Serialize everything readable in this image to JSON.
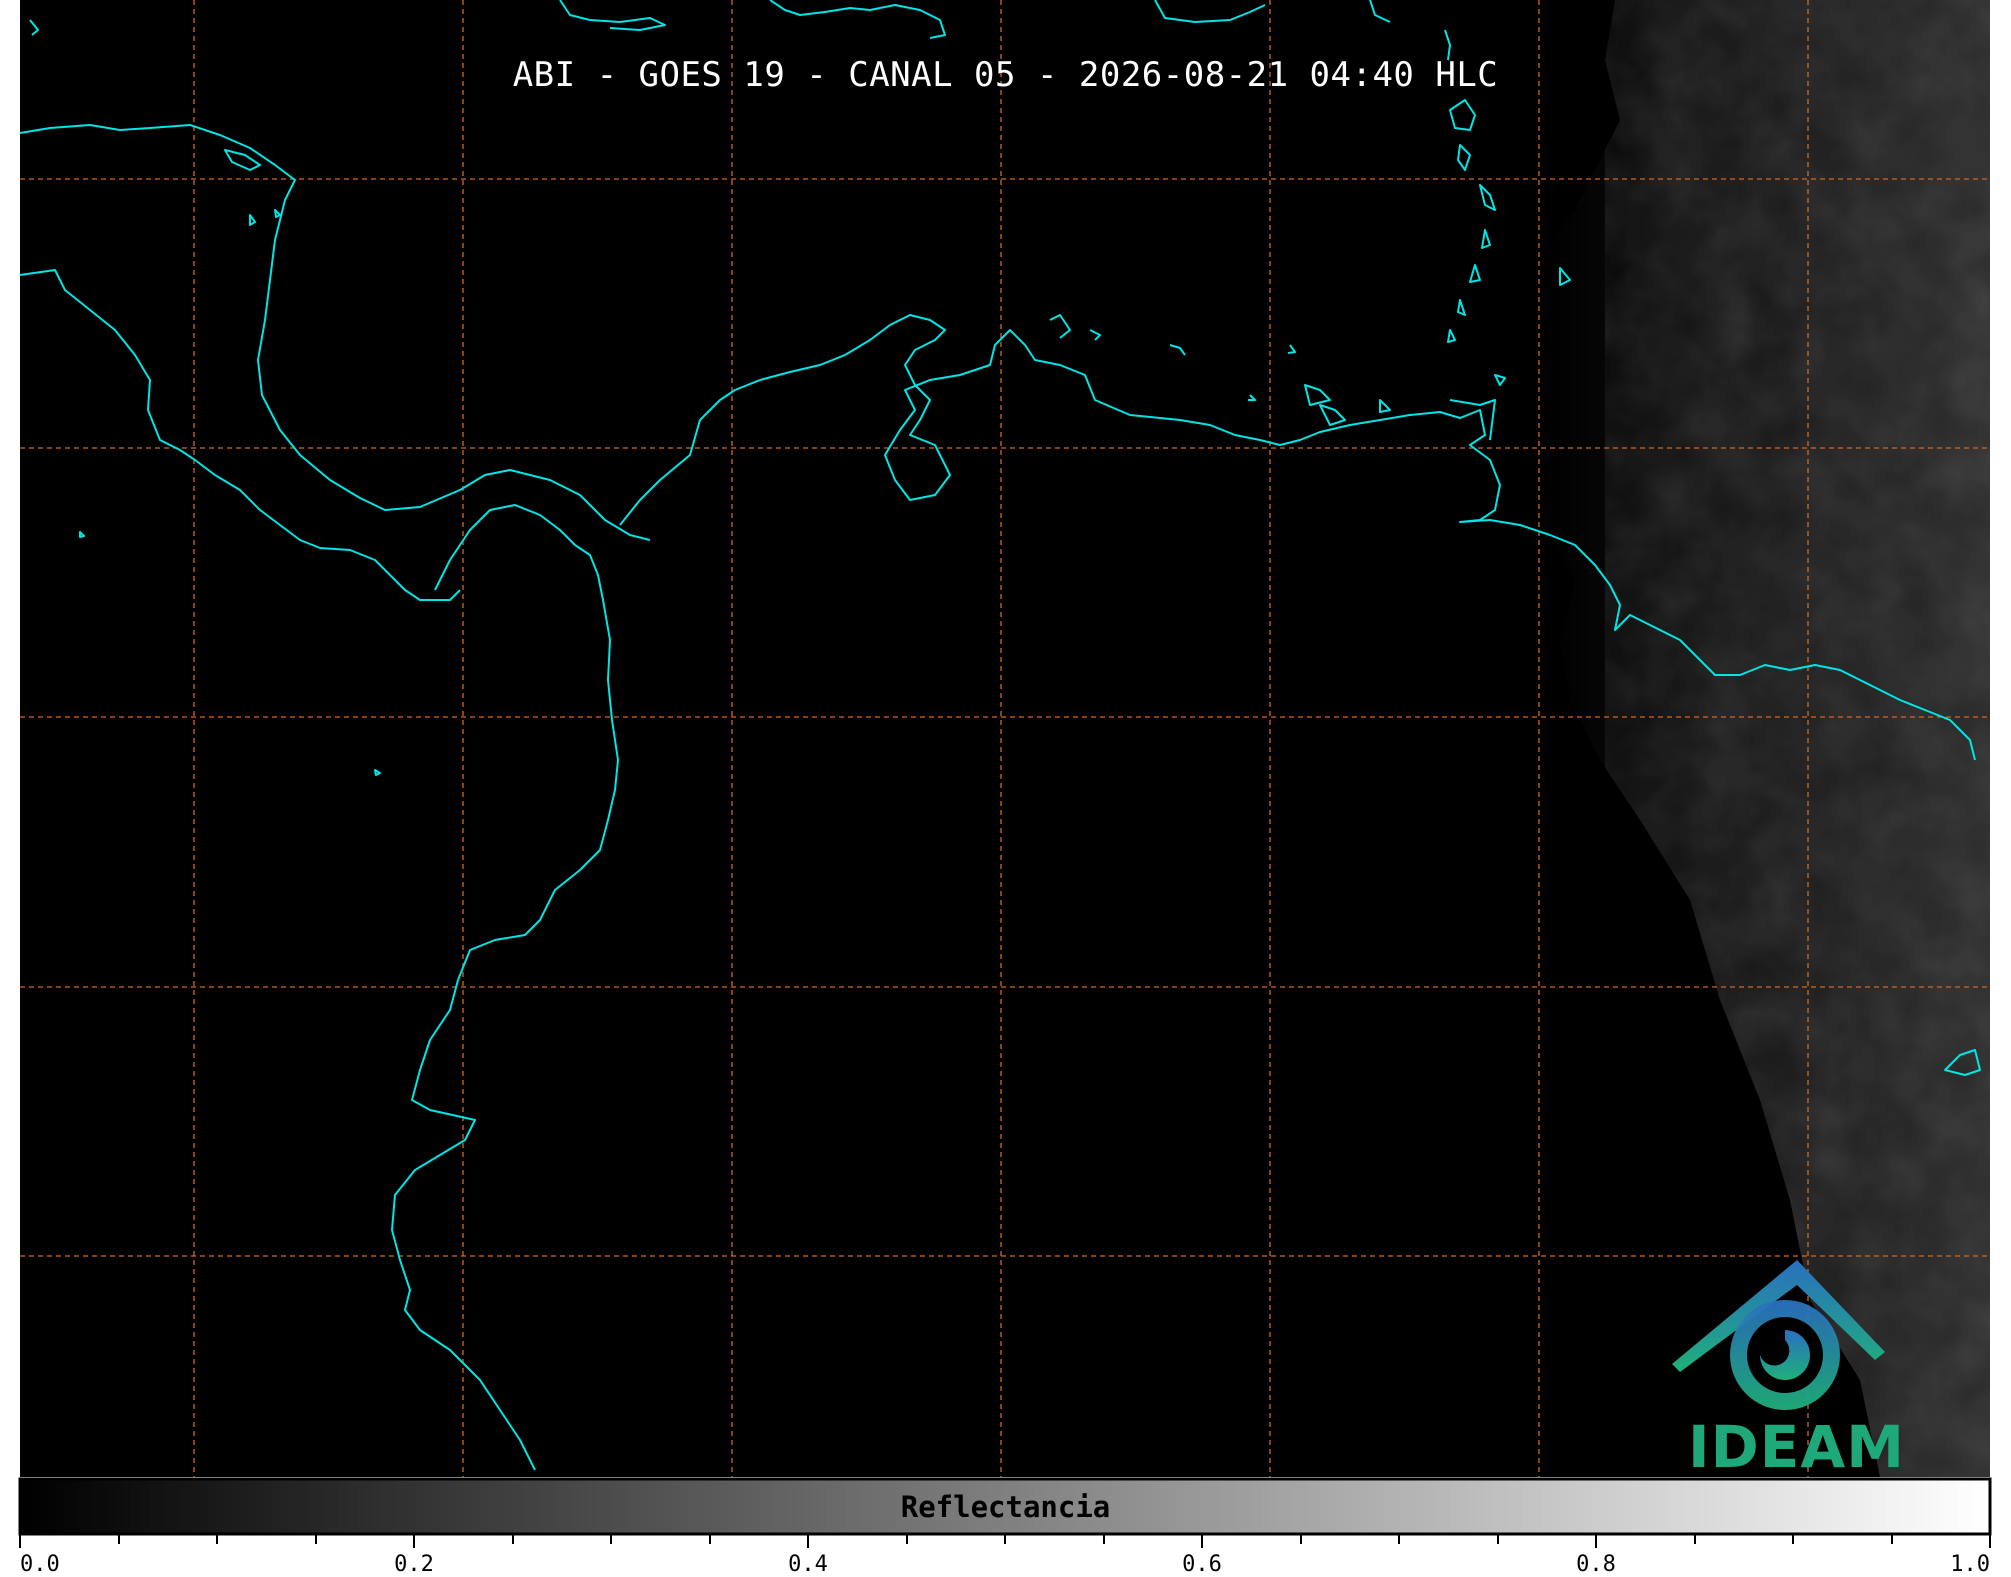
{
  "title": "ABI - GOES 19 - CANAL 05 - 2026-08-21 04:40 HLC",
  "colorbar": {
    "label": "Reflectancia",
    "ticks": [
      "0.0",
      "0.2",
      "0.4",
      "0.6",
      "0.8",
      "1.0"
    ],
    "range": [
      0.0,
      1.0
    ],
    "colormap": [
      "#000000",
      "#ffffff"
    ]
  },
  "logo": {
    "text": "IDEAM"
  },
  "colors": {
    "background": "#000000",
    "coastline": "#00e5e5",
    "graticule": "#d2691e",
    "logo_blue": "#2a7ab8",
    "logo_green": "#1fa87a"
  }
}
